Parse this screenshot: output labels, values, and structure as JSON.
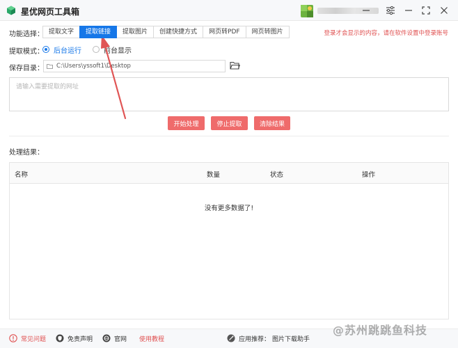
{
  "window": {
    "title": "星优网页工具箱",
    "user_blurred": true
  },
  "function_row": {
    "label": "功能选择：",
    "tabs": [
      {
        "label": "提取文字",
        "active": false
      },
      {
        "label": "提取链接",
        "active": true
      },
      {
        "label": "提取图片",
        "active": false
      },
      {
        "label": "创建快捷方式",
        "active": false
      },
      {
        "label": "网页转PDF",
        "active": false
      },
      {
        "label": "网页转图片",
        "active": false
      }
    ],
    "login_hint": "登录才会显示的内容，请在软件设置中登录账号"
  },
  "mode_row": {
    "label": "提取模式：",
    "options": [
      {
        "label": "后台运行",
        "selected": true
      },
      {
        "label": "前台显示",
        "selected": false
      }
    ]
  },
  "save_row": {
    "label": "保存目录：",
    "path_value": "C:\\Users\\yssoft1\\Desktop"
  },
  "url_input": {
    "placeholder": "请输入需要提取的网址"
  },
  "actions": {
    "start": "开始处理",
    "stop": "停止提取",
    "clear": "清除结果"
  },
  "results": {
    "label": "处理结果：",
    "columns": [
      "名称",
      "数量",
      "状态",
      "操作"
    ],
    "rows": [],
    "empty_text": "没有更多数据了!"
  },
  "footer": {
    "faq": "常见问题",
    "disclaimer": "免责声明",
    "website": "官网",
    "tutorial": "使用教程",
    "recommend_label": "应用推荐：",
    "recommend_app": "图片下载助手",
    "watermark": "@苏州跳跳鱼科技"
  },
  "colors": {
    "accent": "#1677e8",
    "button": "#ef6b6b",
    "hint": "#e05252",
    "tutorial": "#e05252",
    "arrow": "#e05555"
  },
  "icons": {
    "app": "green-cube-icon",
    "minimize": "minimize-icon",
    "settings": "sliders-icon",
    "restore": "maximize-icon",
    "close": "close-icon",
    "folder": "folder-icon",
    "faq": "help-icon",
    "disclaimer": "shield-icon",
    "website": "globe-icon",
    "recommend": "recommend-icon"
  }
}
